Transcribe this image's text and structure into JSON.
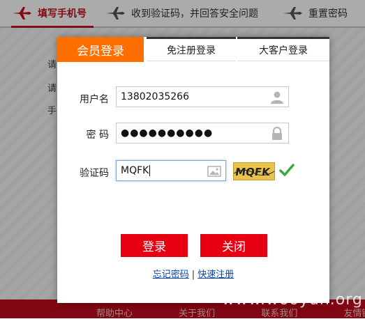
{
  "steps": [
    {
      "label": "填写手机号"
    },
    {
      "label": "收到验证码，并回答安全问题"
    },
    {
      "label": "重置密码"
    }
  ],
  "background": {
    "lines": [
      "请",
      "请",
      "手"
    ],
    "footer_links": [
      "帮助中心",
      "关于我们",
      "联系我们",
      "友情链"
    ]
  },
  "dialog": {
    "tabs": {
      "member_login": "会员登录",
      "free_register": "免注册登录",
      "vip_login": "大客户登录"
    },
    "username": {
      "label": "用户名",
      "value": "13802035266"
    },
    "password": {
      "label": "密  码",
      "value": "●●●●●●●●●●"
    },
    "captcha": {
      "label": "验证码",
      "value": "MQFK",
      "image_text": "MQFK"
    },
    "buttons": {
      "login": "登录",
      "close": "关闭"
    },
    "links": {
      "forgot": "忘记密码",
      "separator": "|",
      "register": "快速注册"
    }
  },
  "watermark": "www.wooyun.org",
  "colors": {
    "accent_orange": "#ff6f00",
    "button_red": "#e60012",
    "step_red": "#c1121f",
    "footer_red": "#c0081c"
  }
}
